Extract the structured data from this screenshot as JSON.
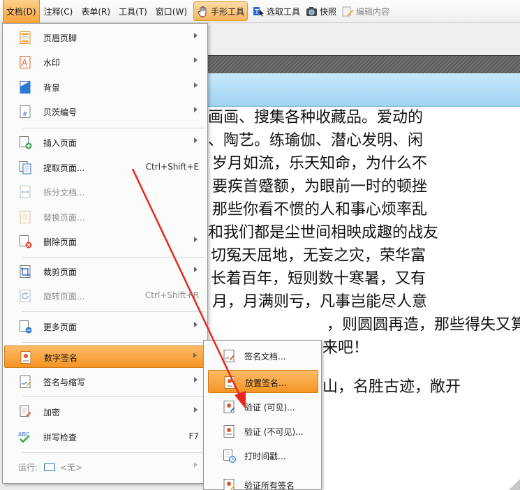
{
  "menubar": {
    "items": [
      "文档(D)",
      "注释(C)",
      "表单(R)",
      "工具(T)",
      "窗口(W)"
    ],
    "tools": [
      {
        "label": "手形工具",
        "icon": "hand-icon"
      },
      {
        "label": "选取工具",
        "icon": "text-select-icon"
      },
      {
        "label": "快照",
        "icon": "camera-icon"
      },
      {
        "label": "编辑内容",
        "icon": "edit-content-icon"
      }
    ]
  },
  "document_menu": {
    "items": [
      {
        "label": "页眉页脚",
        "icon": "header-footer-icon",
        "submenu": true
      },
      {
        "label": "水印",
        "icon": "watermark-icon",
        "submenu": true
      },
      {
        "label": "背景",
        "icon": "background-icon",
        "submenu": true
      },
      {
        "label": "贝茨编号",
        "icon": "bates-numbering-icon",
        "submenu": true
      },
      {
        "label": "插入页面",
        "icon": "insert-page-icon",
        "submenu": true
      },
      {
        "label": "提取页面...",
        "icon": "extract-page-icon",
        "shortcut": "Ctrl+Shift+E"
      },
      {
        "label": "拆分文档...",
        "icon": "split-document-icon",
        "disabled": true
      },
      {
        "label": "替换页面...",
        "icon": "replace-page-icon",
        "disabled": true
      },
      {
        "label": "删除页面",
        "icon": "delete-page-icon",
        "submenu": true
      },
      {
        "label": "裁剪页面",
        "icon": "crop-page-icon",
        "submenu": true
      },
      {
        "label": "旋转页面...",
        "icon": "rotate-page-icon",
        "shortcut": "Ctrl+Shift+R",
        "disabled": true
      },
      {
        "label": "更多页面",
        "icon": "more-pages-icon",
        "submenu": true
      },
      {
        "label": "数字签名",
        "icon": "digital-signature-icon",
        "submenu": true,
        "selected": true
      },
      {
        "label": "签名与缩写",
        "icon": "sign-initials-icon",
        "submenu": true
      },
      {
        "label": "加密",
        "icon": "encrypt-icon",
        "submenu": true
      },
      {
        "label": "拼写检查",
        "icon": "spell-check-icon",
        "shortcut": "F7"
      },
      {
        "label": "运行:",
        "icon": "run-icon",
        "value": "<无>",
        "submenu": true,
        "disabled": true
      }
    ]
  },
  "signature_submenu": {
    "items": [
      {
        "label": "签名文档...",
        "icon": "sign-document-icon"
      },
      {
        "label": "放置签名...",
        "icon": "place-signature-icon",
        "selected": true
      },
      {
        "label": "验证 (可见)...",
        "icon": "validate-visible-icon"
      },
      {
        "label": "验证 (不可见)...",
        "icon": "validate-invisible-icon"
      },
      {
        "label": "打时间戳...",
        "icon": "timestamp-icon"
      },
      {
        "label": "验证所有签名",
        "icon": "validate-all-icon"
      }
    ]
  },
  "document_text": {
    "lines": [
      "画画、搜集各种收藏品。爱动的",
      "、陶艺。练瑜伽、潜心发明、闲",
      "岁月如流，乐天知命，为什么不",
      "要疾首蹙额，为眼前一时的顿挫",
      "那些你看不惯的人和事心烦率乱",
      "和我们都是尘世间相映成趣的战友",
      "切冤天屈地，无妄之灾，荣华富",
      "长着百年，短则数十寒暑，又有",
      "月，月满则亏，凡事岂能尽人意",
      "，则圆圆再造，那些得失又算",
      "来吧！",
      "山，名胜古迹，敞开"
    ]
  },
  "colors": {
    "menu_highlight": "#f49425",
    "annotation_arrow": "#e8281e",
    "title_bar_blue": "#9fd2f2"
  }
}
